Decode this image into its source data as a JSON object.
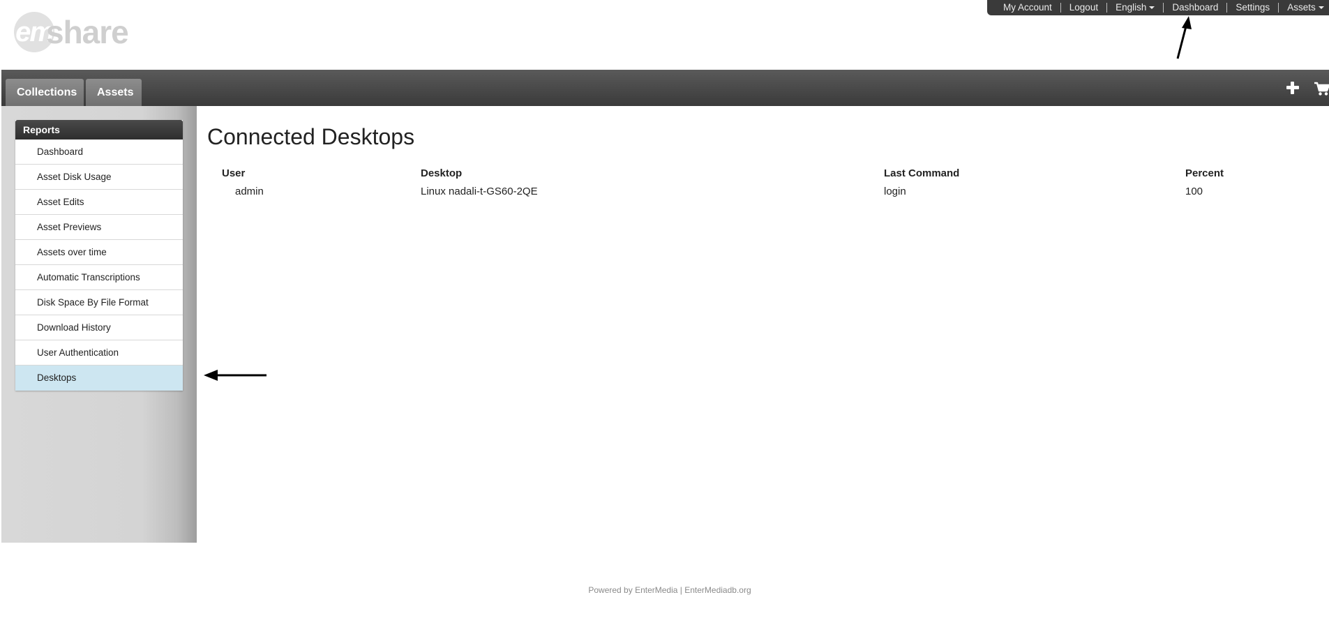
{
  "topbar": {
    "items": [
      {
        "label": "My Account"
      },
      {
        "label": "Logout"
      },
      {
        "label": "English"
      },
      {
        "label": "Dashboard"
      },
      {
        "label": "Settings"
      },
      {
        "label": "Assets"
      }
    ]
  },
  "logo": {
    "prefix": "em",
    "word": "share"
  },
  "nav": {
    "tabs": [
      {
        "label": "Collections"
      },
      {
        "label": "Assets"
      }
    ],
    "icons": [
      "plus-icon",
      "cart-icon"
    ]
  },
  "sidebar": {
    "header": "Reports",
    "items": [
      {
        "label": "Dashboard"
      },
      {
        "label": "Asset Disk Usage"
      },
      {
        "label": "Asset Edits"
      },
      {
        "label": "Asset Previews"
      },
      {
        "label": "Assets over time"
      },
      {
        "label": "Automatic Transcriptions"
      },
      {
        "label": "Disk Space By File Format"
      },
      {
        "label": "Download History"
      },
      {
        "label": "User Authentication"
      },
      {
        "label": "Desktops"
      }
    ],
    "active": "Desktops"
  },
  "main": {
    "title": "Connected Desktops",
    "columns": [
      "User",
      "Desktop",
      "Last Command",
      "Percent"
    ],
    "rows": [
      {
        "user": "admin",
        "desktop": "Linux nadali-t-GS60-2QE",
        "last_command": "login",
        "percent": "100"
      }
    ]
  },
  "footer": {
    "prefix": "Powered by ",
    "link1": "EnterMedia",
    "separator": " | ",
    "link2": "EnterMediadb.org"
  },
  "colors": {
    "nav_dark": "#3a3a3a",
    "active_item": "#cde6f1",
    "logo_gray": "#cfcfcf"
  }
}
